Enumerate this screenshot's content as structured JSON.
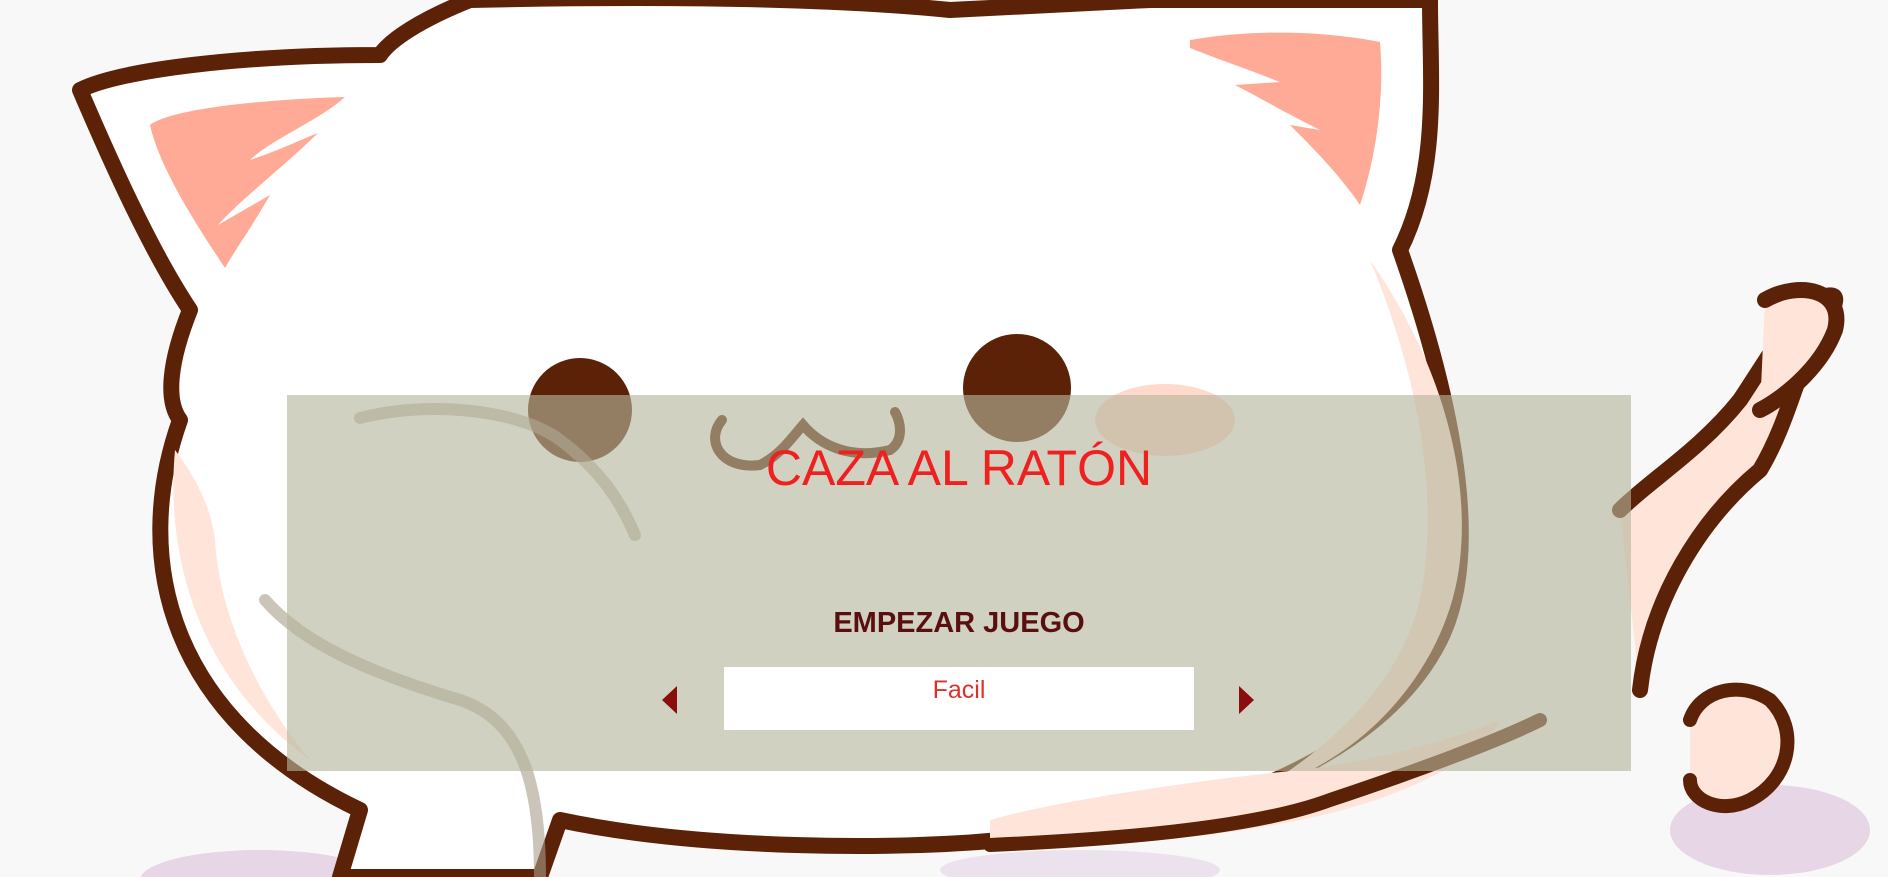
{
  "game": {
    "title": "CAZA AL RATÓN",
    "start_label": "EMPEZAR JUEGO",
    "difficulty": {
      "selected": "Facil"
    }
  },
  "background": {
    "subject": "cat-and-mouse-illustration",
    "colors": {
      "outline": "#5c2208",
      "ear_inner": "#ffaa96",
      "blush": "#ffe4d9",
      "floor": "#e6d6e6",
      "eye": "#5c2208"
    }
  },
  "colors": {
    "page_bg": "#f8f8f8",
    "panel_bg": "#b4b49b",
    "title": "#ef2020",
    "start": "#5a0f0f",
    "arrow": "#8b0e0e",
    "difficulty_text": "#e0302a",
    "difficulty_bg": "#ffffff"
  },
  "icons": {
    "prev": "caret-left-icon",
    "next": "caret-right-icon"
  }
}
